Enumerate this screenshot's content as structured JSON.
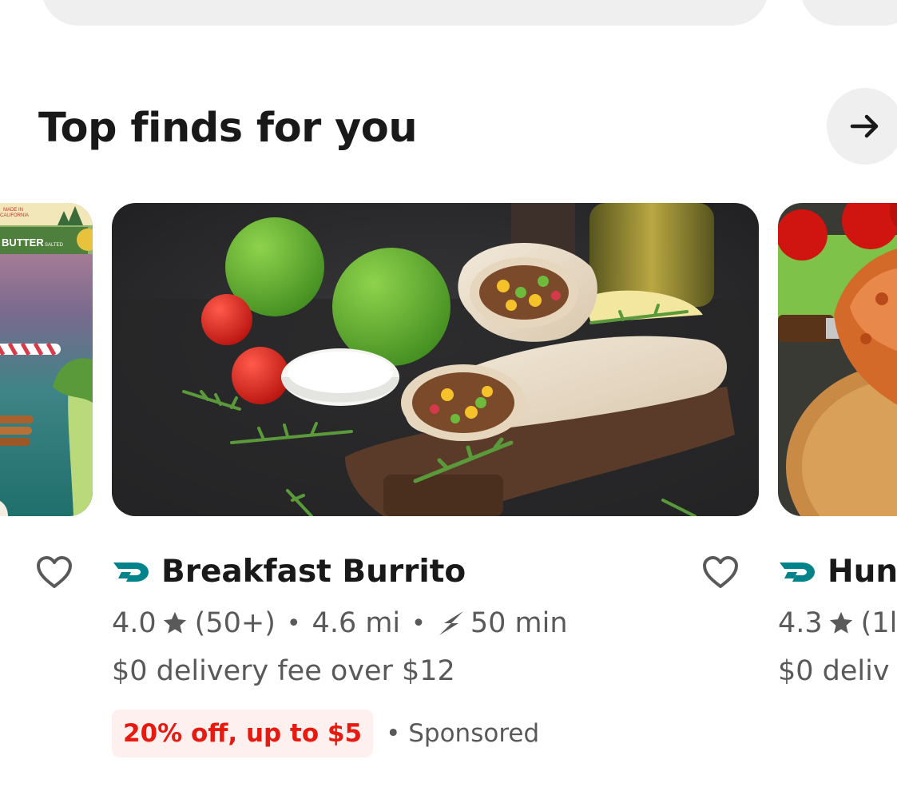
{
  "section": {
    "title": "Top finds for you"
  },
  "cards": {
    "main": {
      "name": "Breakfast Burrito",
      "rating": "4.0",
      "reviews": "(50+)",
      "distance": "4.6 mi",
      "time": "50 min",
      "fee": "$0 delivery fee over $12",
      "promo": "20% off, up to $5",
      "sponsored": "Sponsored"
    },
    "right": {
      "name": "Hun",
      "rating": "4.3",
      "reviews": "(1l",
      "fee": "$0 deliv"
    },
    "left": {
      "image_text": {
        "made_in": "MADE IN",
        "california": "CALIFORNIA",
        "butter": "BUTTER",
        "salted": "SALTED"
      }
    }
  },
  "separators": {
    "dot": "•"
  },
  "icons": {
    "arrow": "arrow-right-icon",
    "heart": "heart-outline-icon",
    "star": "star-icon",
    "bolt": "lightning-icon",
    "dashpass": "dashpass-icon"
  },
  "colors": {
    "accent_teal": "#00838a",
    "promo_red": "#e8190f",
    "promo_bg": "#fdf0ef",
    "muted_text": "#595959",
    "pill_bg": "#efefef"
  }
}
